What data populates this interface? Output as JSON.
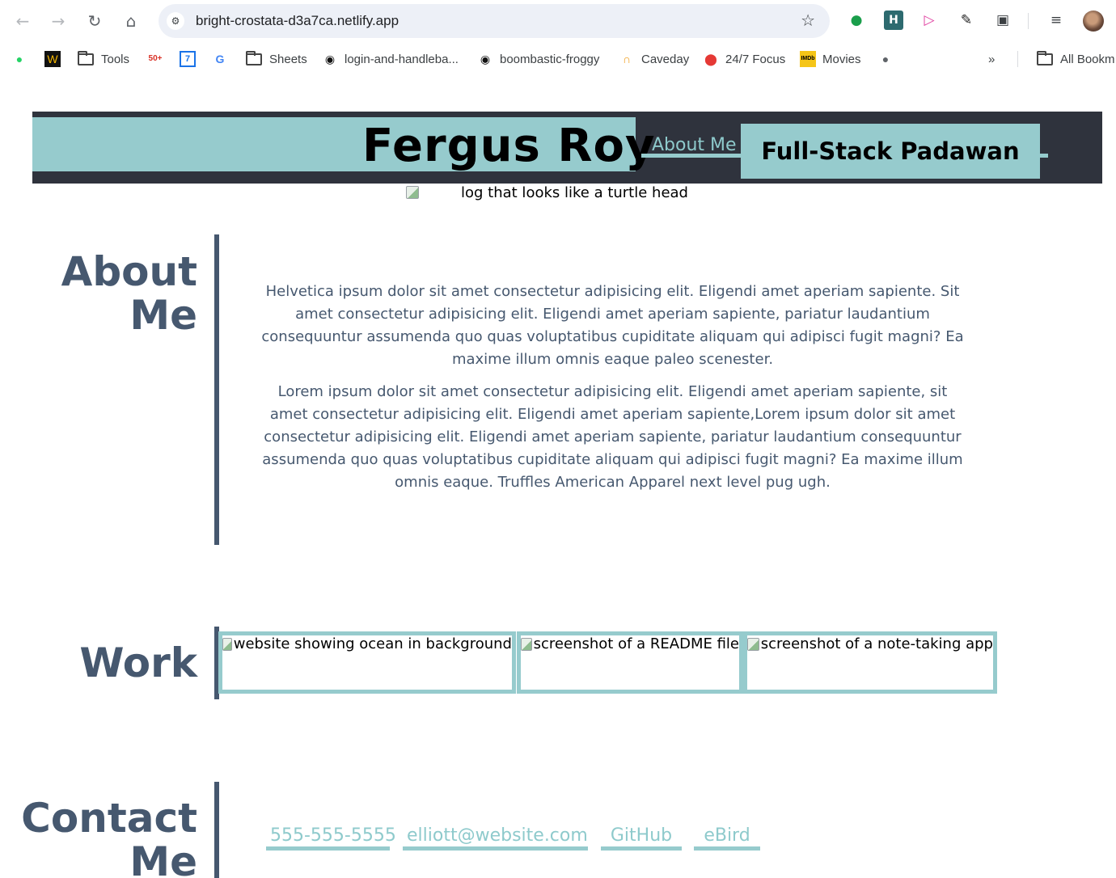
{
  "browser": {
    "url": "bright-crostata-d3a7ca.netlify.app",
    "nav_icons": [
      "back-arrow-icon",
      "forward-arrow-icon",
      "reload-icon",
      "home-icon"
    ],
    "extensions": [
      "evernote-icon",
      "heroku-icon",
      "arrow-extension-icon",
      "eyedropper-icon",
      "puzzle-icon",
      "media-queue-icon"
    ],
    "bookmarks": [
      {
        "label": "",
        "icon": "whatsapp-icon"
      },
      {
        "label": "",
        "icon": "flaticon-icon"
      },
      {
        "label": "Tools",
        "icon": "folder-icon"
      },
      {
        "label": "",
        "icon": "gmail-icon",
        "badge": "50+"
      },
      {
        "label": "",
        "icon": "calendar-icon",
        "badge": "7"
      },
      {
        "label": "",
        "icon": "translate-icon"
      },
      {
        "label": "Sheets",
        "icon": "folder-icon"
      },
      {
        "label": "login-and-handleba...",
        "icon": "github-icon"
      },
      {
        "label": "boombastic-froggy",
        "icon": "github-icon"
      },
      {
        "label": "Caveday",
        "icon": "caveday-icon"
      },
      {
        "label": "24/7 Focus",
        "icon": "focus-icon"
      },
      {
        "label": "Movies",
        "icon": "imdb-icon"
      },
      {
        "label": "",
        "icon": "globe-icon"
      }
    ],
    "more_bookmarks": "»",
    "all_bookmarks": "All Bookm"
  },
  "header": {
    "name": "Fergus Roy",
    "nav_link": "About Me",
    "title": "Full-Stack Padawan",
    "logo_alt": "log that looks like a turtle head"
  },
  "about": {
    "title_line1": "About",
    "title_line2": "Me",
    "paragraphs": [
      "Helvetica ipsum dolor sit amet consectetur adipisicing elit. Eligendi amet aperiam sapiente. Sit amet consectetur adipisicing elit. Eligendi amet aperiam sapiente, pariatur laudantium consequuntur assumenda quo quas voluptatibus cupiditate aliquam qui adipisci fugit magni? Ea maxime illum omnis eaque paleo scenester.",
      "Lorem ipsum dolor sit amet consectetur adipisicing elit. Eligendi amet aperiam sapiente, sit amet consectetur adipisicing elit. Eligendi amet aperiam sapiente,Lorem ipsum dolor sit amet consectetur adipisicing elit. Eligendi amet aperiam sapiente, pariatur laudantium consequuntur assumenda quo quas voluptatibus cupiditate aliquam qui adipisci fugit magni? Ea maxime illum omnis eaque. Truffles American Apparel next level pug ugh."
    ]
  },
  "work": {
    "title": "Work",
    "items": [
      {
        "alt": "website showing ocean in background"
      },
      {
        "alt": "screenshot of a README file"
      },
      {
        "alt": "screenshot of a note-taking app"
      }
    ]
  },
  "contact": {
    "title_line1": "Contact",
    "title_line2": "Me",
    "links": [
      "555-555-5555",
      "elliott@website.com",
      "GitHub",
      "eBird"
    ]
  },
  "colors": {
    "accent": "#96cbcd",
    "dark": "#2f333d",
    "slate": "#46586f"
  }
}
